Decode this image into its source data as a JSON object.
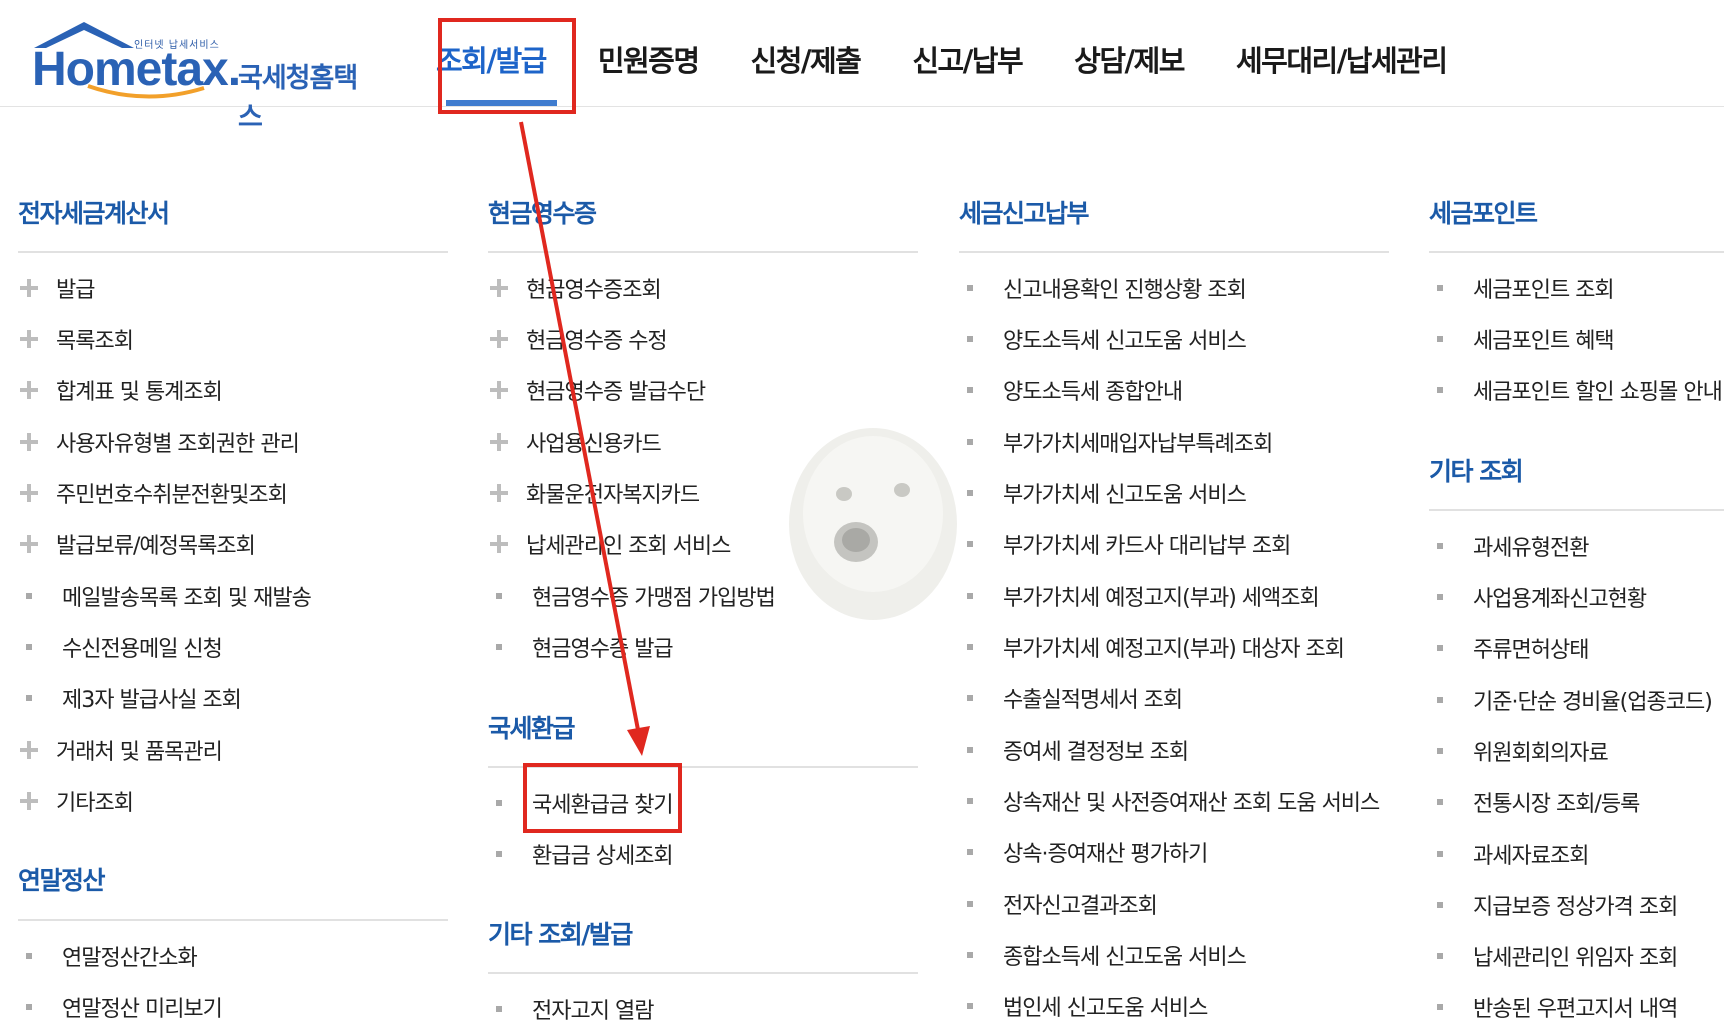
{
  "header": {
    "logo_small": "인터넷 납세서비스",
    "logo_main": "Hometax.",
    "logo_sub": "국세청홈택스",
    "nav": [
      {
        "label": "조회/발급",
        "active": true
      },
      {
        "label": "민원증명",
        "active": false
      },
      {
        "label": "신청/제출",
        "active": false
      },
      {
        "label": "신고/납부",
        "active": false
      },
      {
        "label": "상담/제보",
        "active": false
      },
      {
        "label": "세무대리/납세관리",
        "active": false
      }
    ]
  },
  "columns": {
    "c1": {
      "s1": {
        "title": "전자세금계산서",
        "items": [
          "발급",
          "목록조회",
          "합계표 및 통계조회",
          "사용자유형별 조회권한 관리",
          "주민번호수취분전환및조회",
          "발급보류/예정목록조회",
          "메일발송목록 조회 및 재발송",
          "수신전용메일 신청",
          "제3자 발급사실 조회",
          "거래처 및 품목관리",
          "기타조회"
        ]
      },
      "s2": {
        "title": "연말정산",
        "items": [
          "연말정산간소화",
          "연말정산 미리보기"
        ]
      }
    },
    "c2": {
      "s1": {
        "title": "현금영수증",
        "items": [
          "현금영수증조회",
          "현금영수증 수정",
          "현금영수증 발급수단",
          "사업용신용카드",
          "화물운전자복지카드",
          "납세관리인 조회 서비스",
          "현금영수증 가맹점 가입방법",
          "현금영수증 발급"
        ]
      },
      "s2": {
        "title": "국세환급",
        "items": [
          "국세환급금 찾기",
          "환급금 상세조회"
        ]
      },
      "s3": {
        "title": "기타 조회/발급",
        "items": [
          "전자고지 열람"
        ]
      }
    },
    "c3": {
      "s1": {
        "title": "세금신고납부",
        "items": [
          "신고내용확인 진행상황 조회",
          "양도소득세 신고도움 서비스",
          "양도소득세 종합안내",
          "부가가치세매입자납부특례조회",
          "부가가치세 신고도움 서비스",
          "부가가치세 카드사 대리납부 조회",
          "부가가치세 예정고지(부과) 세액조회",
          "부가가치세 예정고지(부과) 대상자 조회",
          "수출실적명세서 조회",
          "증여세 결정정보 조회",
          "상속재산 및 사전증여재산 조회 도움 서비스",
          "상속·증여재산 평가하기",
          "전자신고결과조회",
          "종합소득세 신고도움 서비스",
          "법인세 신고도움 서비스"
        ]
      }
    },
    "c4": {
      "s1": {
        "title": "세금포인트",
        "items": [
          "세금포인트 조회",
          "세금포인트 혜택",
          "세금포인트 할인 쇼핑몰 안내"
        ]
      },
      "s2": {
        "title": "기타 조회",
        "items": [
          "과세유형전환",
          "사업용계좌신고현황",
          "주류면허상태",
          "기준·단순 경비율(업종코드)",
          "위원회회의자료",
          "전통시장 조회/등록",
          "과세자료조회",
          "지급보증 정상가격 조회",
          "납세관리인 위임자 조회",
          "반송된 우편고지서 내역"
        ]
      }
    }
  },
  "colors": {
    "accent": "#1b5aa8",
    "annotation": "#e0281f"
  }
}
